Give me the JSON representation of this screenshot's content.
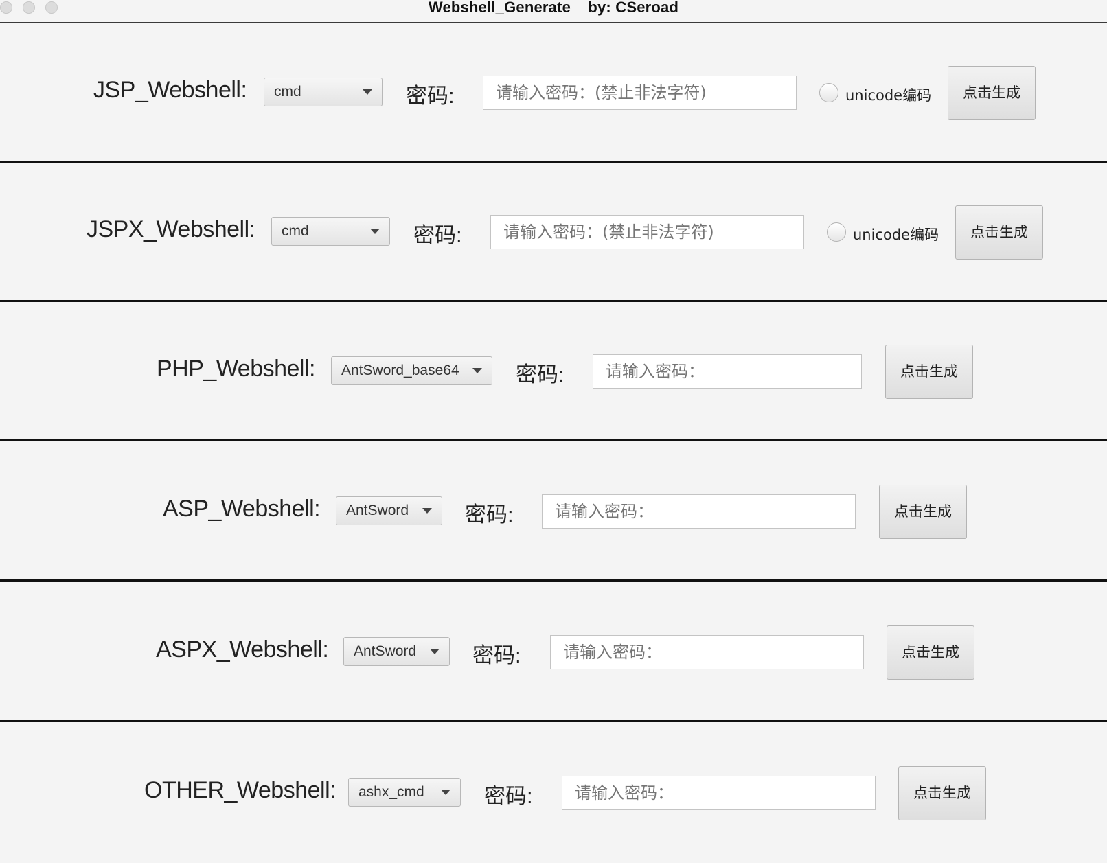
{
  "window": {
    "title": "Webshell_Generate    by: CSeroad"
  },
  "rows": [
    {
      "label": "JSP_Webshell:",
      "select_value": "cmd",
      "password_label": "密码:",
      "password_value": "",
      "password_placeholder": "请输入密码：(禁止非法字符)",
      "radio_label": "unicode编码",
      "radio_checked": false,
      "button_label": "点击生成"
    },
    {
      "label": "JSPX_Webshell:",
      "select_value": "cmd",
      "password_label": "密码:",
      "password_value": "",
      "password_placeholder": "请输入密码：(禁止非法字符)",
      "radio_label": "unicode编码",
      "radio_checked": false,
      "button_label": "点击生成"
    },
    {
      "label": "PHP_Webshell:",
      "select_value": "AntSword_base64",
      "password_label": "密码:",
      "password_value": "",
      "password_placeholder": "请输入密码：",
      "button_label": "点击生成"
    },
    {
      "label": "ASP_Webshell:",
      "select_value": "AntSword",
      "password_label": "密码:",
      "password_value": "",
      "password_placeholder": "请输入密码：",
      "button_label": "点击生成"
    },
    {
      "label": "ASPX_Webshell:",
      "select_value": "AntSword",
      "password_label": "密码:",
      "password_value": "",
      "password_placeholder": "请输入密码：",
      "button_label": "点击生成"
    },
    {
      "label": "OTHER_Webshell:",
      "select_value": "ashx_cmd",
      "password_label": "密码:",
      "password_value": "",
      "password_placeholder": "请输入密码：",
      "button_label": "点击生成"
    }
  ]
}
